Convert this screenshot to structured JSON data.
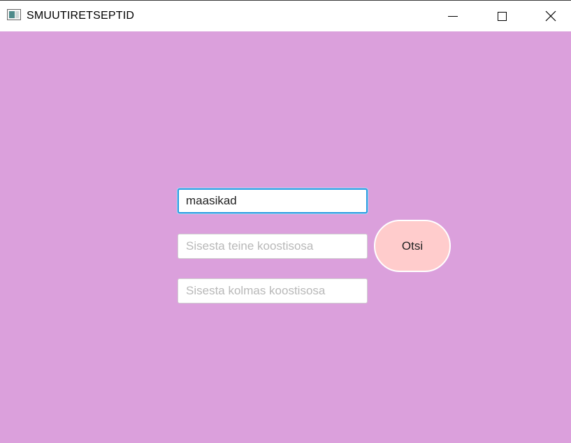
{
  "window": {
    "title": "SMUUTIRETSEPTID"
  },
  "form": {
    "ingredient1": {
      "value": "maasikad",
      "placeholder": ""
    },
    "ingredient2": {
      "value": "",
      "placeholder": "Sisesta teine koostisosa"
    },
    "ingredient3": {
      "value": "",
      "placeholder": "Sisesta kolmas koostisosa"
    },
    "search_label": "Otsi"
  },
  "colors": {
    "background": "#dba0dc",
    "button": "#ffcccc",
    "focus": "#2b9be0"
  }
}
